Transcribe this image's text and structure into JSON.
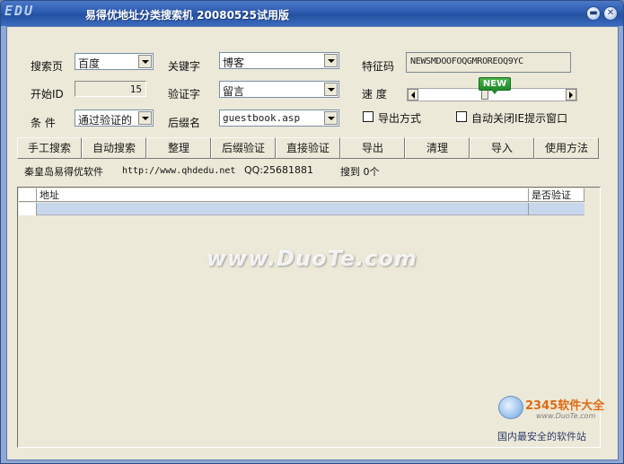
{
  "window": {
    "logo_text": "EDU",
    "title": "易得优地址分类搜索机  20080525试用版",
    "minimize_glyph": "▬",
    "close_glyph": "✕"
  },
  "form": {
    "search_page_label": "搜索页",
    "search_page_value": "百度",
    "keyword_label": "关键字",
    "keyword_value": "博客",
    "code_label": "特征码",
    "code_value": "NEWSMDOOFOQGMROREOQ9YC",
    "start_id_label": "开始ID",
    "start_id_value": "15",
    "verify_word_label": "验证字",
    "verify_word_value": "留言",
    "speed_label": "速  度",
    "speed_level_percent": 45,
    "new_badge": "NEW",
    "condition_label": "条  件",
    "condition_value": "通过验证的",
    "suffix_label": "后缀名",
    "suffix_value": "guestbook.asp",
    "export_mode_label": "导出方式",
    "export_mode_checked": false,
    "auto_close_label": "自动关闭IE提示窗口",
    "auto_close_checked": false
  },
  "toolbar": {
    "buttons": [
      {
        "label": "手工搜索"
      },
      {
        "label": "自动搜索"
      },
      {
        "label": "整理"
      },
      {
        "label": "后缀验证"
      },
      {
        "label": "直接验证"
      },
      {
        "label": "导出"
      },
      {
        "label": "清理"
      },
      {
        "label": "导入"
      },
      {
        "label": "使用方法"
      }
    ]
  },
  "info": {
    "company": "秦皇岛易得优软件",
    "url": "http://www.qhdedu.net",
    "qq": "QQ:25681881",
    "found": "搜到 0个"
  },
  "list": {
    "columns": [
      {
        "label": "地址"
      },
      {
        "label": "是否验证"
      }
    ]
  },
  "watermarks": {
    "duote": "www.DuoTe.com",
    "brand_2345": "2345软件大全",
    "site_2345": "www.DuoTe.com",
    "slogan": "国内最安全的软件站"
  },
  "colors": {
    "titlebar": "#2c5bb0",
    "client_bg": "#ece9d8",
    "selected_row": "#c8d7ee",
    "new_badge": "#1f8a2a"
  }
}
